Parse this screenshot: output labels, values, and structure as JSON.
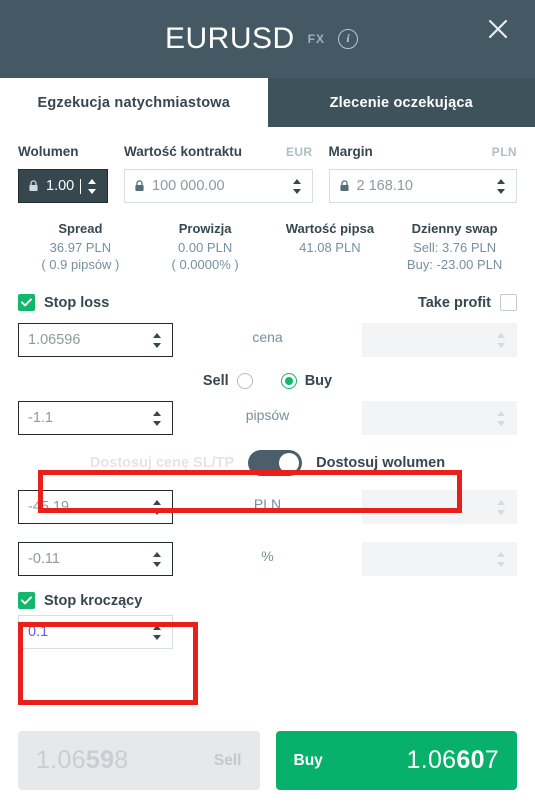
{
  "header": {
    "symbol": "EURUSD",
    "badge": "FX",
    "info_icon": "info-icon",
    "close_icon": "close-icon",
    "bg_color": "#455964"
  },
  "tabs": [
    {
      "label": "Egzekucja natychmiastowa",
      "active": true
    },
    {
      "label": "Zlecenie oczekująca",
      "active": false
    }
  ],
  "fields": {
    "volume": {
      "label": "Wolumen",
      "currency": "",
      "value": "1.00",
      "locked": true,
      "focused": true
    },
    "contract_value": {
      "label": "Wartość kontraktu",
      "currency": "EUR",
      "value": "100 000.00",
      "locked": true
    },
    "margin": {
      "label": "Margin",
      "currency": "PLN",
      "value": "2 168.10",
      "locked": true
    }
  },
  "stats": [
    {
      "head": "Spread",
      "value": "36.97 PLN",
      "value2": "( 0.9 pipsów )"
    },
    {
      "head": "Prowizja",
      "value": "0.00 PLN",
      "value2": "( 0.0000% )"
    },
    {
      "head": "Wartość pipsa",
      "value": "41.08 PLN",
      "value2": ""
    },
    {
      "head": "Dzienny swap",
      "value": "Sell: 3.76 PLN",
      "value2": "Buy: -23.00 PLN"
    }
  ],
  "stop_loss": {
    "label": "Stop loss",
    "checked": true
  },
  "take_profit": {
    "label": "Take profit",
    "checked": false
  },
  "rows": [
    {
      "unit": "cena",
      "sl_value": "1.06596",
      "tp_value": ""
    },
    {
      "unit": "pipsów",
      "sl_value": "-1.1",
      "tp_value": ""
    },
    {
      "unit": "PLN",
      "sl_value": "-45.19",
      "tp_value": ""
    },
    {
      "unit": "%",
      "sl_value": "-0.11",
      "tp_value": ""
    }
  ],
  "direction": {
    "sell_label": "Sell",
    "buy_label": "Buy",
    "selected": "Buy"
  },
  "adjust_toggle": {
    "left_label": "Dostosuj cenę SL/TP",
    "right_label": "Dostosuj wolumen",
    "active": "right"
  },
  "trailing_stop": {
    "label": "Stop kroczący",
    "checked": true,
    "value": "0.1"
  },
  "order_buttons": {
    "sell": {
      "word": "Sell",
      "price_pre": "1.06",
      "price_big": "59",
      "price_post": "8",
      "enabled": false
    },
    "buy": {
      "word": "Buy",
      "price_pre": "1.06",
      "price_big": "60",
      "price_post": "7",
      "enabled": true,
      "color": "#08b16b"
    }
  },
  "highlights": [
    {
      "name": "adjust-toggle-highlight",
      "color": "#e8201b"
    },
    {
      "name": "trailing-stop-highlight",
      "color": "#e8201b"
    }
  ]
}
